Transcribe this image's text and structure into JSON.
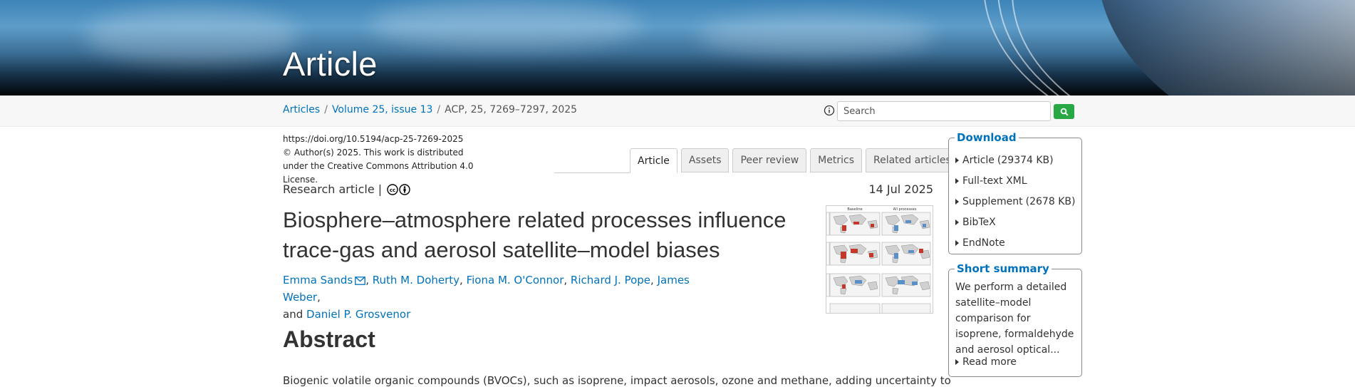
{
  "banner": {
    "title": "Article"
  },
  "breadcrumb": {
    "items": [
      {
        "label": "Articles"
      },
      {
        "label": "Volume 25, issue 13"
      }
    ],
    "current": "ACP, 25, 7269–7297, 2025"
  },
  "search": {
    "placeholder": "Search"
  },
  "meta": {
    "doi": "https://doi.org/10.5194/acp-25-7269-2025",
    "license": "© Author(s) 2025. This work is distributed under the Creative Commons Attribution 4.0 License."
  },
  "tabs": [
    {
      "label": "Article",
      "active": true
    },
    {
      "label": "Assets",
      "active": false
    },
    {
      "label": "Peer review",
      "active": false
    },
    {
      "label": "Metrics",
      "active": false
    },
    {
      "label": "Related articles",
      "active": false
    }
  ],
  "article": {
    "type": "Research article |",
    "date": "14 Jul 2025",
    "title": "Biosphere–atmosphere related processes influence trace-gas and aerosol satellite–model biases",
    "authors": [
      "Emma Sands",
      "Ruth M. Doherty",
      "Fiona M. O'Connor",
      "Richard J. Pope",
      "James Weber"
    ],
    "last_author_prefix": "and",
    "last_author": "Daniel P. Grosvenor",
    "thumbnail_labels": [
      "Baseline",
      "All processes"
    ]
  },
  "abstract": {
    "heading": "Abstract",
    "text": "Biogenic volatile organic compounds (BVOCs), such as isoprene, impact aerosols, ozone and methane, adding uncertainty to"
  },
  "download": {
    "title": "Download",
    "items": [
      {
        "label": "Article",
        "size": "(29374 KB)"
      },
      {
        "label": "Full-text XML",
        "size": ""
      },
      {
        "label": "Supplement",
        "size": "(2678 KB)"
      },
      {
        "label": "BibTeX",
        "size": ""
      },
      {
        "label": "EndNote",
        "size": ""
      }
    ]
  },
  "summary": {
    "title": "Short summary",
    "text": "We perform a detailed satellite–model comparison for isoprene, formaldehyde and aerosol optical...",
    "read_more": "Read more"
  },
  "colors": {
    "link": "#0072bc",
    "search_button": "#28a745",
    "heading": "#333333"
  },
  "icons": [
    "info-icon",
    "search-icon",
    "cc-icon",
    "cc-by-icon",
    "mail-icon",
    "caret-right-icon"
  ]
}
